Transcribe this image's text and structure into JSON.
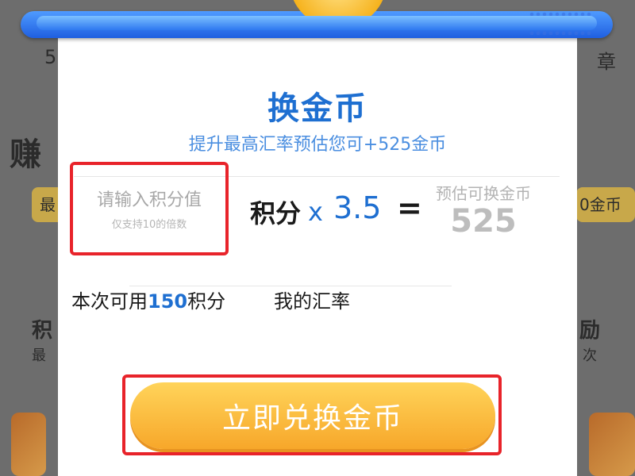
{
  "background": {
    "frag_top_left": "5",
    "frag_top_right": "章",
    "frag_earn": "赚",
    "frag_pill_left": "最",
    "frag_pill_right": "0金币",
    "frag_mid_left": "积",
    "frag_mid_left2": "最",
    "frag_mid_right": "励",
    "frag_mid_right2": "次"
  },
  "dialog": {
    "title": "换金币",
    "subtitle": "提升最高汇率预估您可+525金币",
    "input": {
      "placeholder": "请输入积分值",
      "hint": "仅支持10的倍数"
    },
    "formula": {
      "points_label": "积分",
      "times": "x",
      "rate": "3.5",
      "equals": "="
    },
    "estimate": {
      "label": "预估可换金币",
      "value": "525"
    },
    "available": {
      "prefix": "本次可用",
      "points": "150",
      "suffix": "积分"
    },
    "my_rate_label": "我的汇率",
    "exchange_button": "立即兑换金币"
  },
  "colors": {
    "accent_blue": "#1e6fd1",
    "highlight_red": "#e8232a",
    "button_orange": "#f7a72a"
  }
}
